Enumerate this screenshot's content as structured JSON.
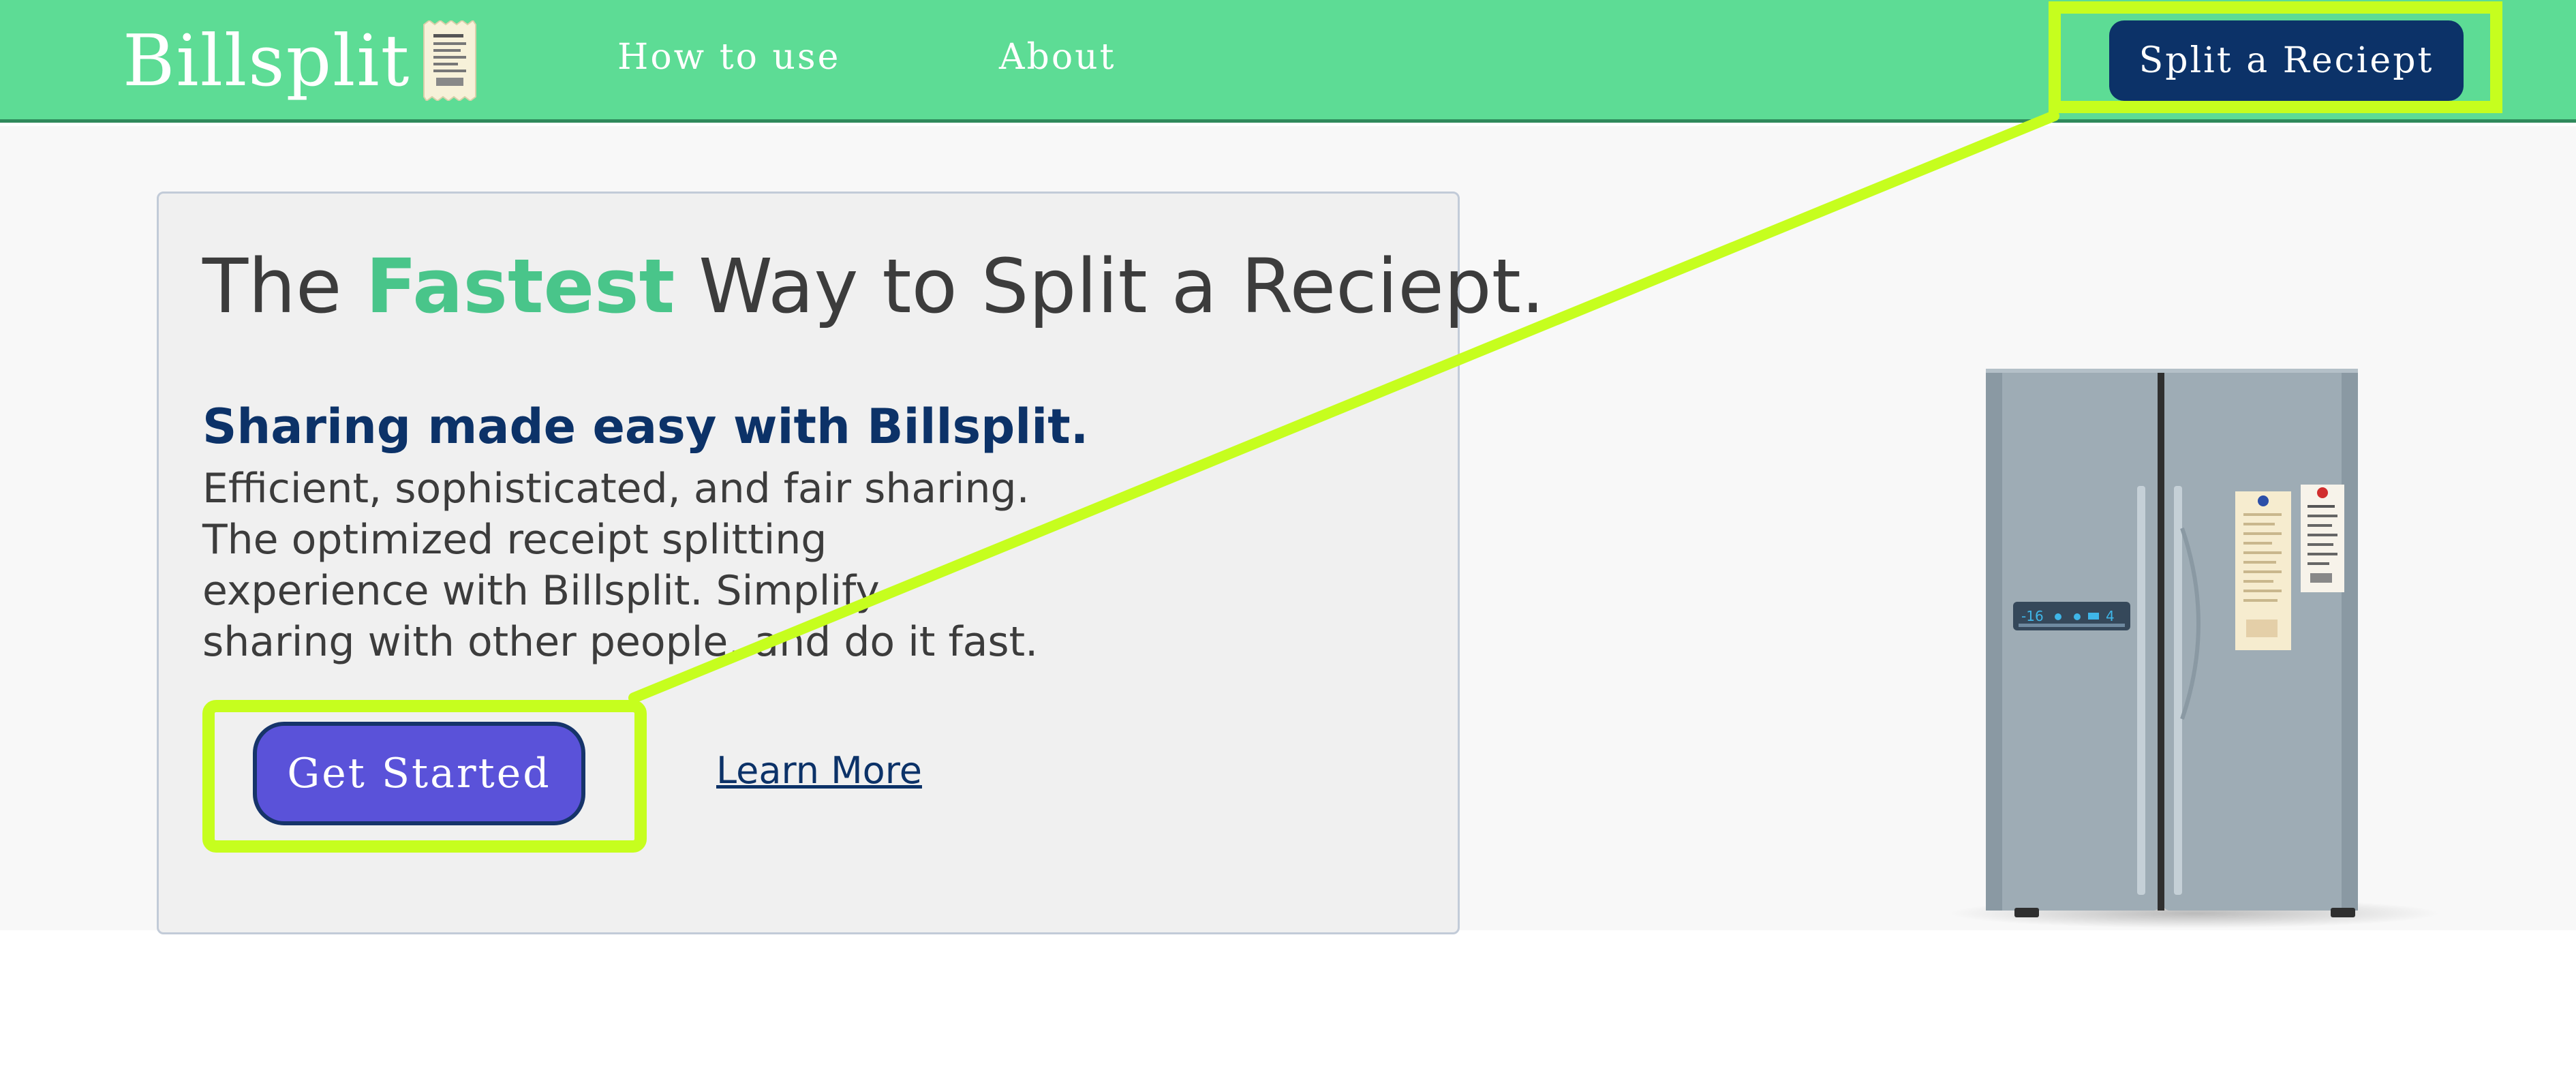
{
  "nav": {
    "brand": "Billsplit",
    "links": [
      "How to use",
      "About"
    ],
    "cta_label": "Split a Reciept"
  },
  "hero": {
    "headline_before": "The ",
    "headline_accent": "Fastest",
    "headline_after": " Way to Split a Reciept.",
    "subhead": "Sharing made easy with Billsplit.",
    "body": "Efficient, sophisticated, and fair sharing. The optimized receipt splitting experience with Billsplit. Simplify sharing with other people, and do it fast.",
    "primary_button": "Get Started",
    "secondary_link": "Learn More"
  },
  "fridge_display": {
    "temp_left": "-16",
    "temp_right": "4"
  },
  "colors": {
    "nav_bg": "#5ddc95",
    "navy": "#0c3268",
    "accent_green": "#49c58a",
    "button_purple": "#5a52d9",
    "highlight": "#c6fe1e"
  }
}
